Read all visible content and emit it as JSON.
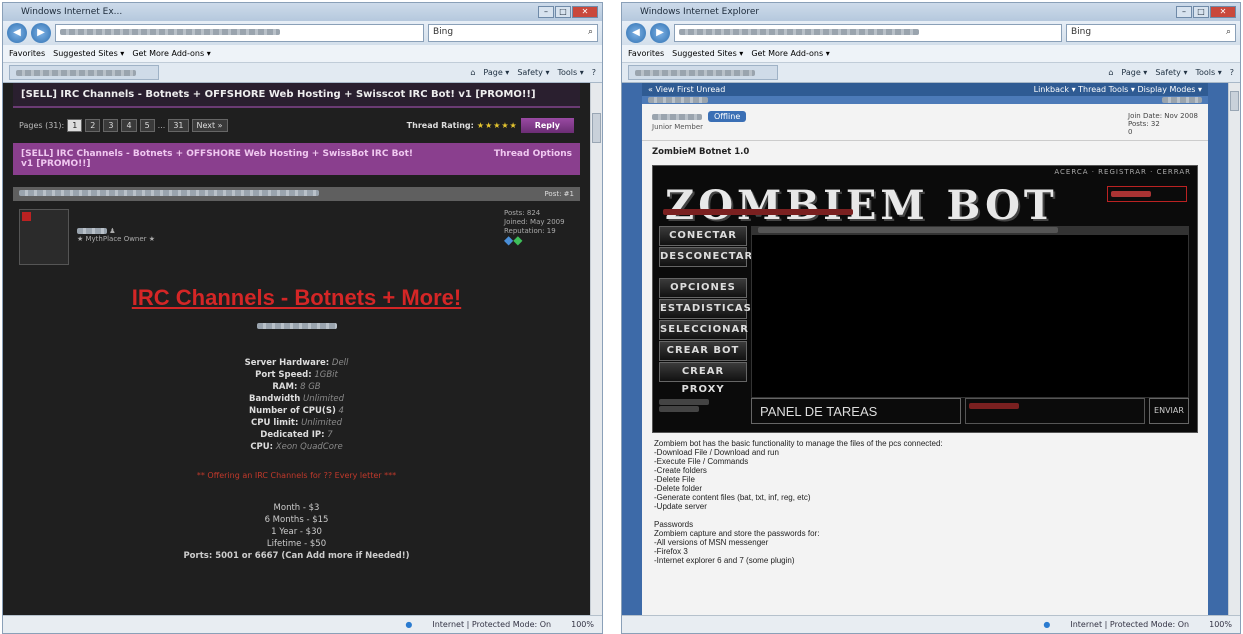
{
  "left_window": {
    "title": "Windows Internet Ex...",
    "search_placeholder": "Bing",
    "favorites": [
      "Favorites",
      "Suggested Sites ▾",
      "Get More Add-ons ▾"
    ],
    "commands": [
      "Page ▾",
      "Safety ▾",
      "Tools ▾"
    ],
    "breadcrumb": "[SELL] IRC Channels - Botnets + OFFSHORE Web Hosting + Swisscot IRC Bot! v1 [PROMO!!]",
    "pager": {
      "label": "Pages (31):",
      "pages": [
        "1",
        "2",
        "3",
        "4",
        "5",
        "...",
        "31",
        "Next »"
      ]
    },
    "thread_rating_label": "Thread Rating:",
    "stars": "★★★★★",
    "reply_label": "Reply",
    "thread_header": "[SELL] IRC Channels - Botnets + OFFSHORE Web Hosting + SwissBot IRC Bot! v1 [PROMO!!]",
    "thread_options": "Thread Options",
    "post_number": "Post: #1",
    "user_title": "★ MythPlace Owner ★",
    "stats": [
      "Posts: 824",
      "Joined: May 2009",
      "Reputation: 19"
    ],
    "big_title": "IRC Channels - Botnets + More!",
    "specs": [
      {
        "k": "Server Hardware:",
        "v": "Dell"
      },
      {
        "k": "Port Speed:",
        "v": "1GBit"
      },
      {
        "k": "RAM:",
        "v": "8 GB"
      },
      {
        "k": "Bandwidth",
        "v": "Unlimited"
      },
      {
        "k": "Number of CPU(S)",
        "v": "4"
      },
      {
        "k": "CPU limit:",
        "v": "Unlimited"
      },
      {
        "k": "Dedicated IP:",
        "v": "7"
      },
      {
        "k": "CPU:",
        "v": "Xeon QuadCore"
      }
    ],
    "offer": "** Offering an IRC Channels for ?? Every letter ***",
    "prices": [
      "Month - $3",
      "6 Months - $15",
      "1 Year - $30",
      "Lifetime - $50"
    ],
    "ports": "Ports: 5001 or 6667 (Can Add more if Needed!)",
    "status": "Internet | Protected Mode: On",
    "zoom": "100%"
  },
  "right_window": {
    "title": "Windows Internet Explorer",
    "search_placeholder": "Bing",
    "favorites": [
      "Favorites",
      "Suggested Sites ▾",
      "Get More Add-ons ▾"
    ],
    "commands": [
      "Page ▾",
      "Safety ▾",
      "Tools ▾"
    ],
    "toprow_left": "« View First Unread",
    "toprow_right": "Linkback ▾  Thread Tools ▾  Display Modes ▾",
    "rank": "Junior Member",
    "offline": "Offline",
    "join_info": [
      "Join Date: Nov 2008",
      "Posts: 32",
      "0"
    ],
    "post_title": "ZombieM Botnet 1.0",
    "zb_menu": "ACERCA · REGISTRAR · CERRAR",
    "zb_logo": "ZOMBIEM BOT",
    "zb_buttons": [
      "CONECTAR",
      "DESCONECTAR",
      "OPCIONES",
      "ESTADISTICAS",
      "SELECCIONAR",
      "CREAR BOT",
      "CREAR PROXY"
    ],
    "zb_panel": "PANEL DE TAREAS",
    "zb_send": "ENVIAR",
    "desc": [
      "Zombiem bot has the basic functionality to manage the files of the pcs connected:",
      "-Download File / Download and run",
      "-Execute File / Commands",
      "-Create folders",
      "-Delete File",
      "-Delete folder",
      "-Generate content files (bat, txt, inf, reg, etc)",
      "-Update server",
      "",
      "Passwords",
      "Zombiem capture and store the passwords for:",
      "-All versions of MSN messenger",
      "-Firefox 3",
      "-Internet explorer 6 and 7 (some plugin)"
    ],
    "status": "Internet | Protected Mode: On",
    "zoom": "100%"
  }
}
